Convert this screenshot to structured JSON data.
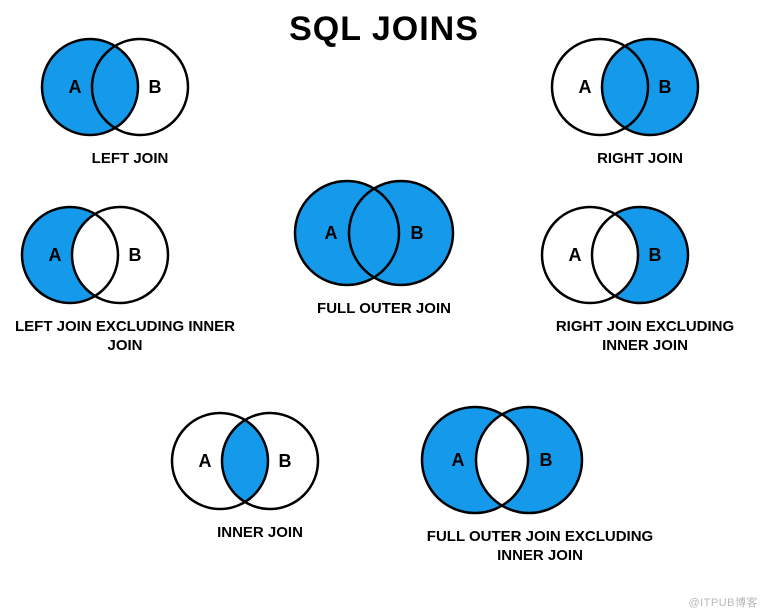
{
  "title": "SQL JOINS",
  "fillColor": "#1499eb",
  "strokeColor": "#000",
  "labelA": "A",
  "labelB": "B",
  "watermark": "@ITPUB博客",
  "joins": {
    "left": {
      "caption": "LEFT JOIN"
    },
    "right": {
      "caption": "RIGHT JOIN"
    },
    "leftExcl": {
      "caption": "LEFT JOIN EXCLUDING INNER JOIN"
    },
    "rightExcl": {
      "caption": "RIGHT JOIN EXCLUDING INNER JOIN"
    },
    "fullOuter": {
      "caption": "FULL OUTER JOIN"
    },
    "inner": {
      "caption": "INNER JOIN"
    },
    "fullExcl": {
      "caption": "FULL OUTER JOIN EXCLUDING INNER JOIN"
    }
  }
}
